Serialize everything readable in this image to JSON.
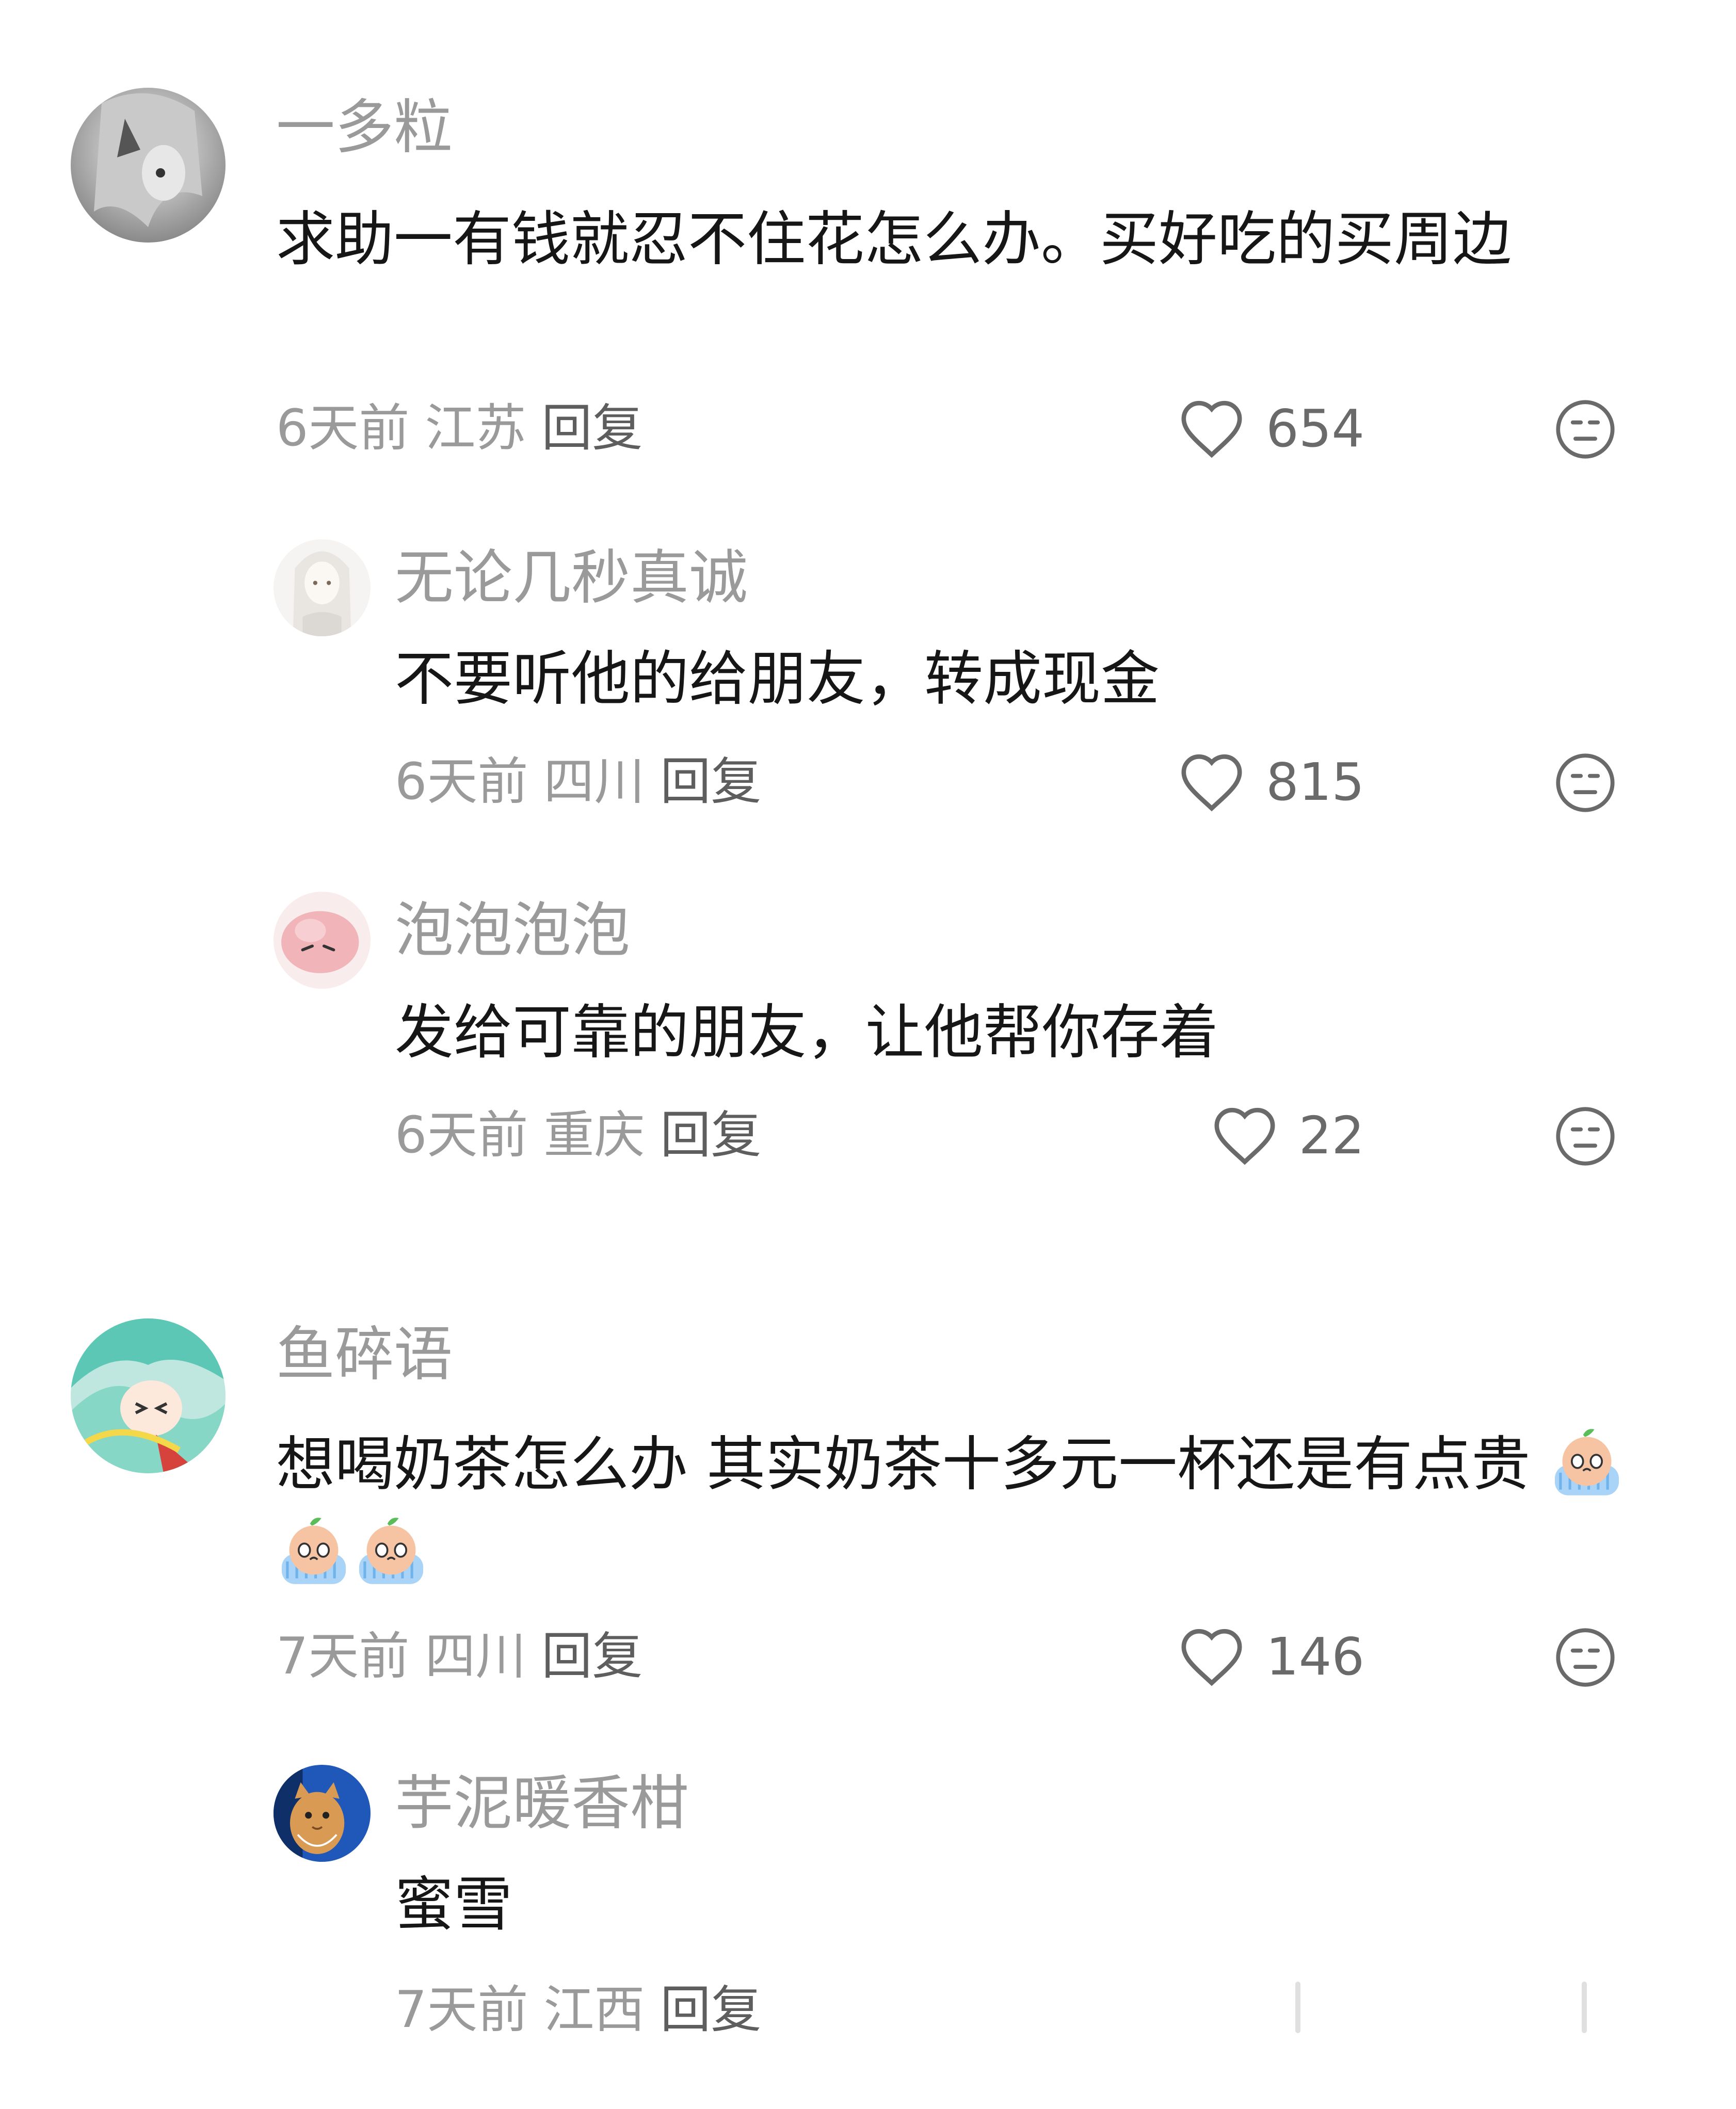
{
  "comments": [
    {
      "username": "一多粒",
      "text": "求助一有钱就忍不住花怎么办。买好吃的买周边",
      "time": "6天前",
      "location": "江苏",
      "reply_label": "回复",
      "likes": "654"
    },
    {
      "username": "无论几秒真诚",
      "text": "不要听他的给朋友，转成现金",
      "time": "6天前",
      "location": "四川",
      "reply_label": "回复",
      "likes": "815"
    },
    {
      "username": "泡泡泡泡",
      "text": "发给可靠的朋友，让他帮你存着",
      "time": "6天前",
      "location": "重庆",
      "reply_label": "回复",
      "likes": "22"
    },
    {
      "username": "鱼碎语",
      "text": "想喝奶茶怎么办 其实奶茶十多元一杯还是有点贵",
      "time": "7天前",
      "location": "四川",
      "reply_label": "回复",
      "likes": "146"
    },
    {
      "username": "芋泥暖香柑",
      "text": "蜜雪",
      "time": "7天前",
      "location": "江西",
      "reply_label": "回复",
      "likes": ""
    }
  ],
  "icons": {
    "like": "heart-outline-icon",
    "dislike": "neutral-face-icon",
    "crying_emoji": "crying-peach-emoji"
  },
  "colors": {
    "username": "#9a9a9a",
    "text": "#161616",
    "meta": "#9a9a9a",
    "icon": "#6a6a6a"
  }
}
